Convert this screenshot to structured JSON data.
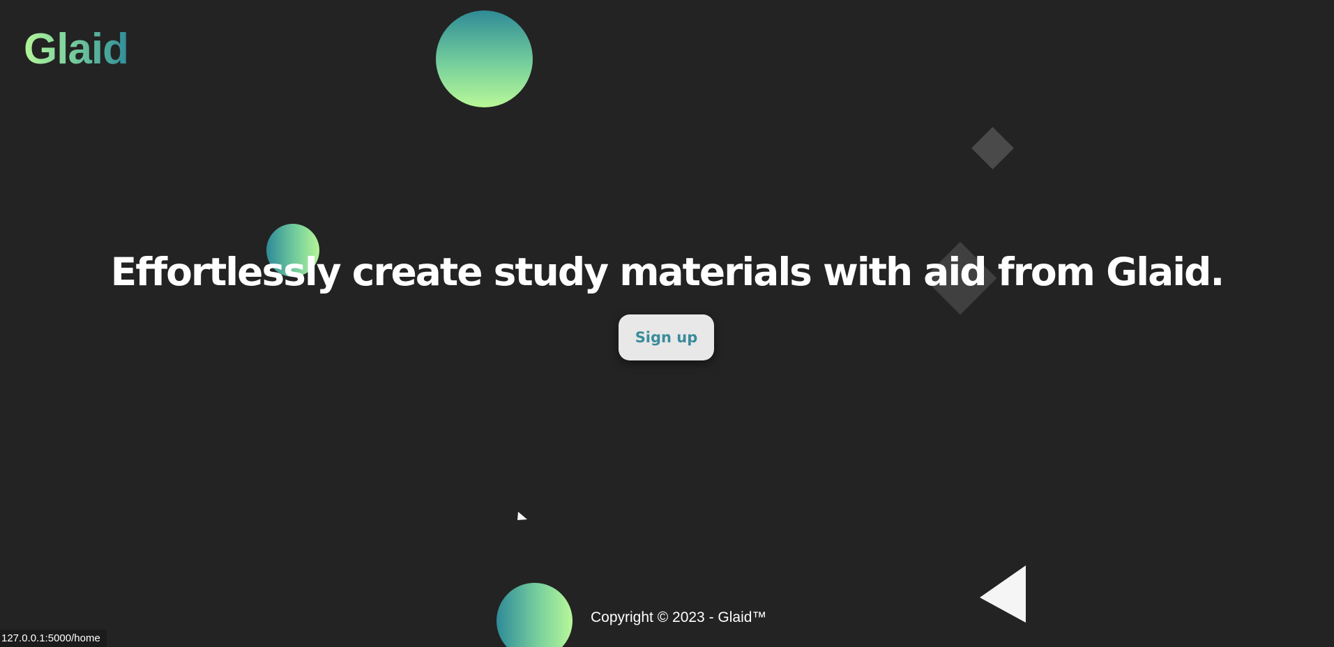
{
  "header": {
    "logo_text": "Glaid"
  },
  "hero": {
    "headline": "Effortlessly create study materials with aid from Glaid.",
    "signup_label": "Sign up"
  },
  "footer": {
    "copyright": "Copyright © 2023 - Glaid™"
  },
  "status_bar": {
    "url": "127.0.0.1:5000/home"
  },
  "colors": {
    "background": "#232323",
    "gradient_light": "#b8f799",
    "gradient_dark": "#2f8a98",
    "button_bg": "#e8e8e8",
    "button_text": "#3a8c99",
    "diamond": "#4a4a4a",
    "triangle": "#f5f5f5"
  }
}
